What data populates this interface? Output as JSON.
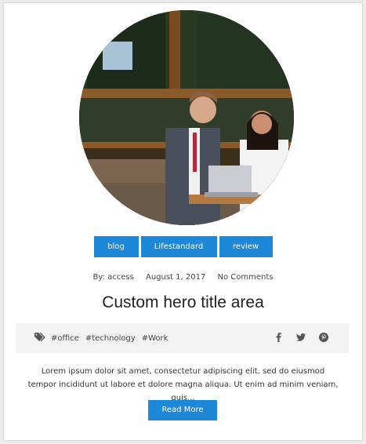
{
  "post": {
    "categories": [
      "blog",
      "Lifestandard",
      "review"
    ],
    "meta": {
      "author": "By: access",
      "date": "August 1, 2017",
      "comments": "No Comments"
    },
    "title": "Custom hero title area",
    "tags": [
      "#office",
      "#technology",
      "#Work"
    ],
    "social_icons": [
      "facebook-icon",
      "twitter-icon",
      "pinterest-icon"
    ],
    "excerpt": "Lorem ipsum dolor sit amet, consectetur adipiscing elit, sed do eiusmod tempor incididunt ut labore et dolore magna aliqua. Ut enim ad minim veniam, quis...",
    "read_more": "Read More"
  },
  "colors": {
    "accent": "#1e88d8",
    "tag_bar_bg": "#f3f3f3"
  }
}
